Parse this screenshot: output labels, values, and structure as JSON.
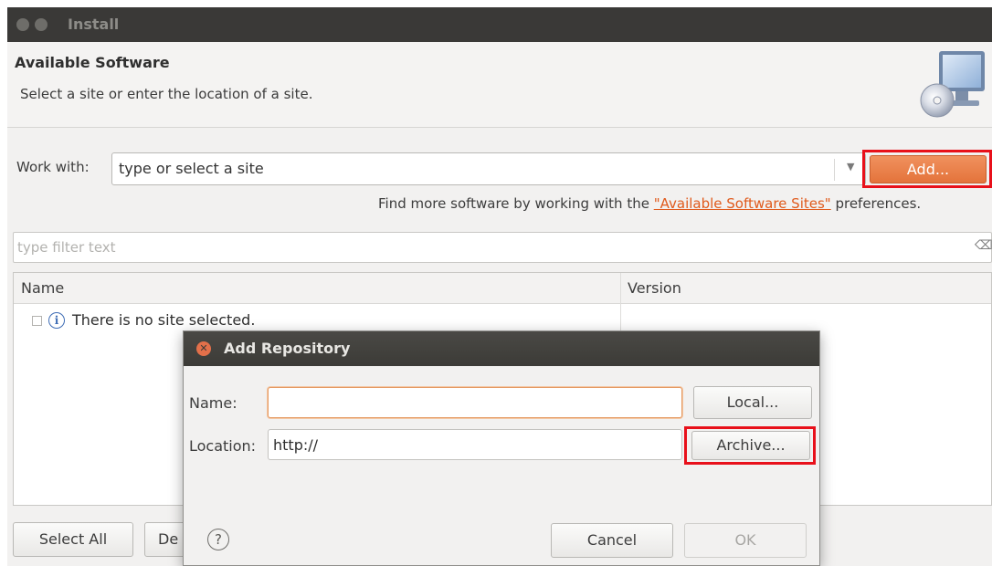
{
  "window": {
    "title": "Install"
  },
  "header": {
    "title": "Available Software",
    "description": "Select a site or enter the location of a site.",
    "icon": "install-software-icon"
  },
  "work_with": {
    "label": "Work with:",
    "combo_text": "type or select a site",
    "dropdown_icon": "chevron-down-icon",
    "add_label": "Add...",
    "add_highlighted": true
  },
  "more_software": {
    "prefix": "Find more software by working with the ",
    "link": "\"Available Software Sites\"",
    "suffix": " preferences."
  },
  "filter": {
    "placeholder": "type filter text",
    "clear_icon": "clear-icon"
  },
  "table": {
    "columns": [
      "Name",
      "Version"
    ],
    "rows": [
      {
        "checked": false,
        "icon": "info-icon",
        "name": "There is no site selected.",
        "version": ""
      }
    ]
  },
  "bottom_buttons": {
    "select_all": "Select All",
    "deselect_all_visible": "De"
  },
  "dialog": {
    "title": "Add Repository",
    "close_icon": "close-icon",
    "name_label": "Name:",
    "name_value": "",
    "local_button": "Local...",
    "location_label": "Location:",
    "location_value": "http://",
    "archive_button": "Archive...",
    "archive_highlighted": true,
    "help_icon": "help-icon",
    "cancel_button": "Cancel",
    "ok_button": "OK",
    "ok_enabled": false
  },
  "colors": {
    "accent_orange": "#e4733b",
    "highlight_red": "#e8101a",
    "link_orange": "#e05a1c",
    "titlebar_dark": "#3a3937"
  }
}
